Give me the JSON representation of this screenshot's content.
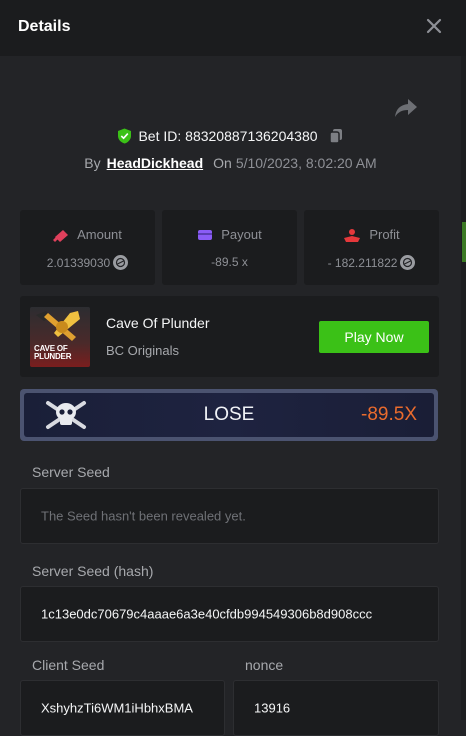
{
  "header": {
    "title": "Details"
  },
  "bet": {
    "id_label": "Bet ID: 88320887136204380",
    "by_label": "By",
    "username": "HeadDickhead",
    "on_label": "On",
    "datetime": "5/10/2023, 8:02:20 AM"
  },
  "stats": {
    "amount": {
      "label": "Amount",
      "value": "2.01339030"
    },
    "payout": {
      "label": "Payout",
      "value": "-89.5 x"
    },
    "profit": {
      "label": "Profit",
      "value": "- 182.211822"
    }
  },
  "game": {
    "thumb_text": "CAVE OF PLUNDER",
    "name": "Cave Of Plunder",
    "provider": "BC Originals",
    "play_label": "Play Now"
  },
  "result": {
    "word": "LOSE",
    "multiplier": "-89.5X"
  },
  "server_seed": {
    "label": "Server Seed",
    "value": "The Seed hasn't been revealed yet."
  },
  "server_seed_hash": {
    "label": "Server Seed (hash)",
    "value": "1c13e0dc70679c4aaae6a3e40cfdb994549306b8d908ccc"
  },
  "client_seed": {
    "label": "Client Seed",
    "value": "XshyhzTi6WM1iHbhxBMA"
  },
  "nonce": {
    "label": "nonce",
    "value": "13916"
  },
  "colors": {
    "background": "#232427",
    "panel": "#1b1c1e",
    "accent_green": "#3bc117",
    "loss_orange": "#ea6b2d",
    "amount_icon": "#e0405c",
    "payout_icon": "#8b5cf6",
    "profit_icon": "#e5383b"
  },
  "icons": [
    "close-icon",
    "share-icon",
    "verified-shield-icon",
    "copy-icon",
    "amount-icon",
    "payout-icon",
    "profit-icon",
    "coin-icon",
    "skull-icon"
  ]
}
